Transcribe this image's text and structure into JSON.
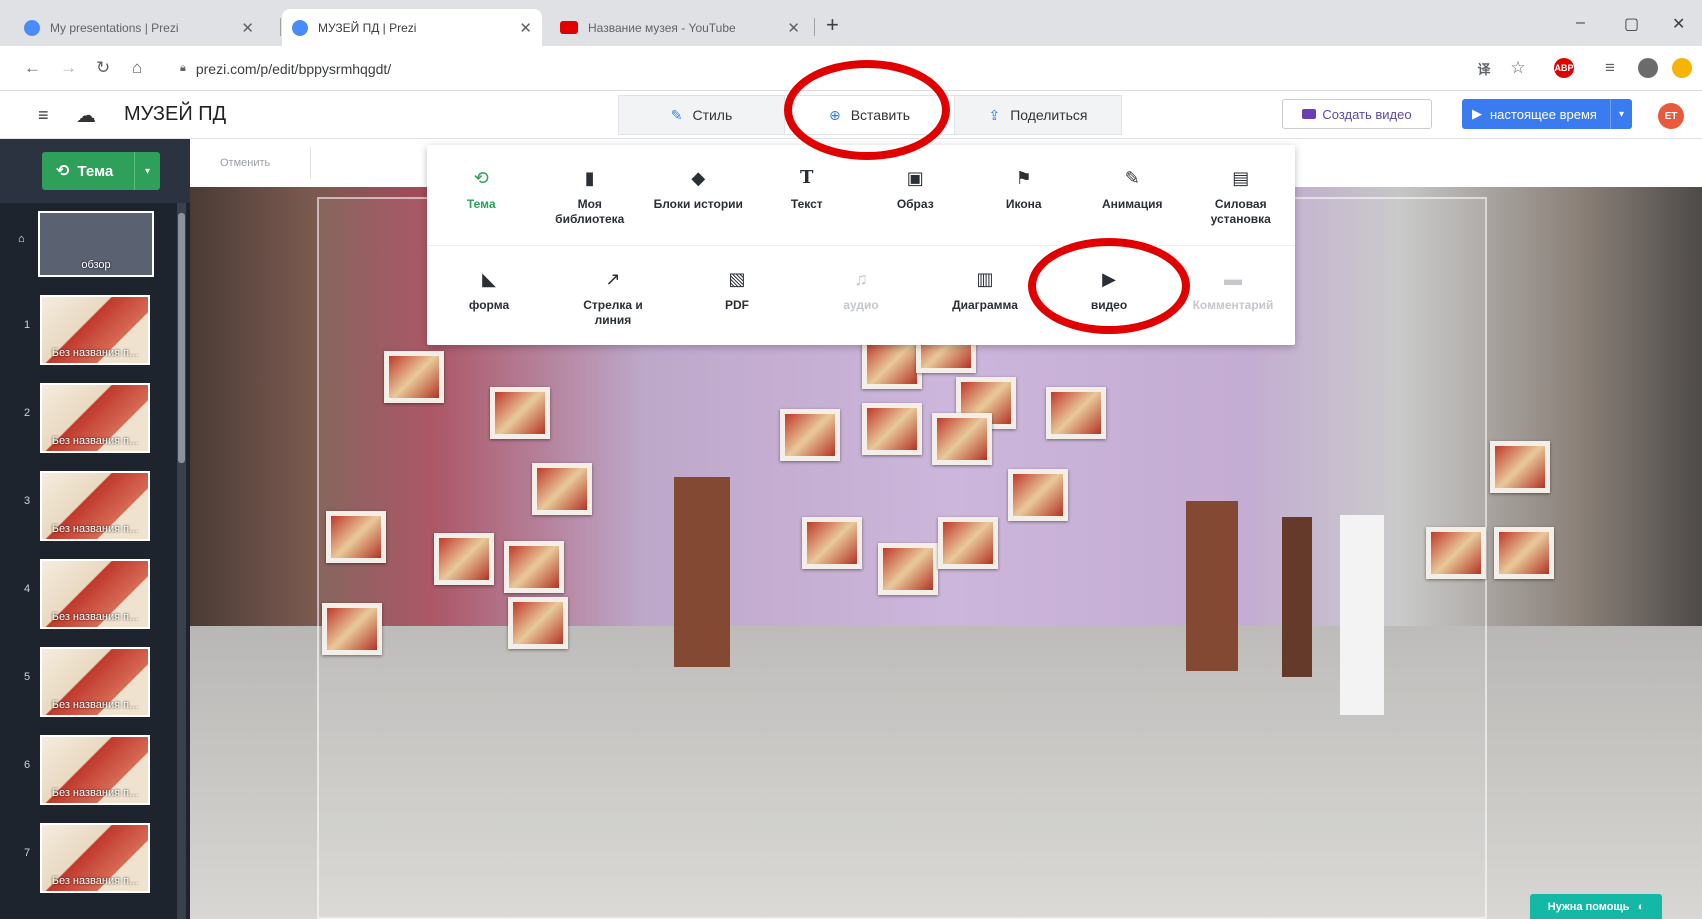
{
  "browser": {
    "tabs": [
      {
        "title": "My presentations | Prezi",
        "favicon_color": "#4a8cf7",
        "active": false
      },
      {
        "title": "МУЗЕЙ ПД | Prezi",
        "favicon_color": "#4a8cf7",
        "active": true
      },
      {
        "title": "Название музея - YouTube",
        "favicon_color": "#e00000",
        "active": false
      }
    ],
    "address": "prezi.com/p/edit/bppysrmhqgdt/",
    "window_controls": {
      "minimize": "–",
      "maximize": "▢",
      "close": "✕"
    },
    "new_tab": "+",
    "extensions": [
      {
        "name": "translate-icon",
        "label": "译",
        "color": "#5f6368"
      },
      {
        "name": "star-icon",
        "label": "☆",
        "color": "#5f6368"
      },
      {
        "name": "adblock-icon",
        "label": "ABP",
        "color": "#e00000"
      },
      {
        "name": "playlist-icon",
        "label": "≡",
        "color": "#5f6368"
      },
      {
        "name": "profile-icon",
        "label": "",
        "color": "#6b6b6b"
      },
      {
        "name": "notification-icon",
        "label": "",
        "color": "#f4b400"
      }
    ]
  },
  "header": {
    "title": "МУЗЕЙ ПД",
    "tabs": {
      "style": "Стиль",
      "insert": "Вставить",
      "share": "Поделиться"
    },
    "create_video": "Создать видео",
    "present": "настоящее время",
    "avatar_initials": "ЕТ"
  },
  "sidebar": {
    "topic_button": "Тема",
    "overview_label": "обзор",
    "thumbnails": [
      {
        "number": "1",
        "caption": "Без названия п..."
      },
      {
        "number": "2",
        "caption": "Без названия п..."
      },
      {
        "number": "3",
        "caption": "Без названия п..."
      },
      {
        "number": "4",
        "caption": "Без названия п..."
      },
      {
        "number": "5",
        "caption": "Без названия п..."
      },
      {
        "number": "6",
        "caption": "Без названия п..."
      },
      {
        "number": "7",
        "caption": "Без названия п..."
      }
    ]
  },
  "toolbar": {
    "undo": "Отменить"
  },
  "insert_menu": {
    "row1": [
      {
        "icon": "topic-icon",
        "glyph": "⟲",
        "label": "Тема",
        "state": "active"
      },
      {
        "icon": "library-icon",
        "glyph": "▮",
        "label": "Моя библиотека",
        "state": "normal"
      },
      {
        "icon": "story-blocks-icon",
        "glyph": "◆",
        "label": "Блоки истории",
        "state": "normal"
      },
      {
        "icon": "text-icon",
        "glyph": "T",
        "label": "Текст",
        "state": "normal"
      },
      {
        "icon": "image-icon",
        "glyph": "▣",
        "label": "Образ",
        "state": "normal"
      },
      {
        "icon": "flag-icon",
        "glyph": "⚑",
        "label": "Икона",
        "state": "normal"
      },
      {
        "icon": "animation-icon",
        "glyph": "✎",
        "label": "Анимация",
        "state": "normal"
      },
      {
        "icon": "powerpoint-icon",
        "glyph": "▤",
        "label": "Силовая установка",
        "state": "normal"
      }
    ],
    "row2": [
      {
        "icon": "shape-icon",
        "glyph": "◣",
        "label": "форма",
        "state": "normal"
      },
      {
        "icon": "arrow-icon",
        "glyph": "↗",
        "label": "Стрелка и линия",
        "state": "normal"
      },
      {
        "icon": "pdf-icon",
        "glyph": "▧",
        "label": "PDF",
        "state": "normal"
      },
      {
        "icon": "audio-icon",
        "glyph": "♫",
        "label": "аудио",
        "state": "disabled"
      },
      {
        "icon": "chart-icon",
        "glyph": "▥",
        "label": "Диаграмма",
        "state": "normal"
      },
      {
        "icon": "video-icon",
        "glyph": "▶",
        "label": "видео",
        "state": "normal"
      },
      {
        "icon": "comment-icon",
        "glyph": "▬",
        "label": "Комментарий",
        "state": "disabled"
      }
    ]
  },
  "help_button": "Нужна помощь",
  "colors": {
    "accent_green": "#2ea05a",
    "present_blue": "#3a7bf0",
    "highlight_red": "#e00000",
    "sidebar_dark": "#2b3340"
  }
}
